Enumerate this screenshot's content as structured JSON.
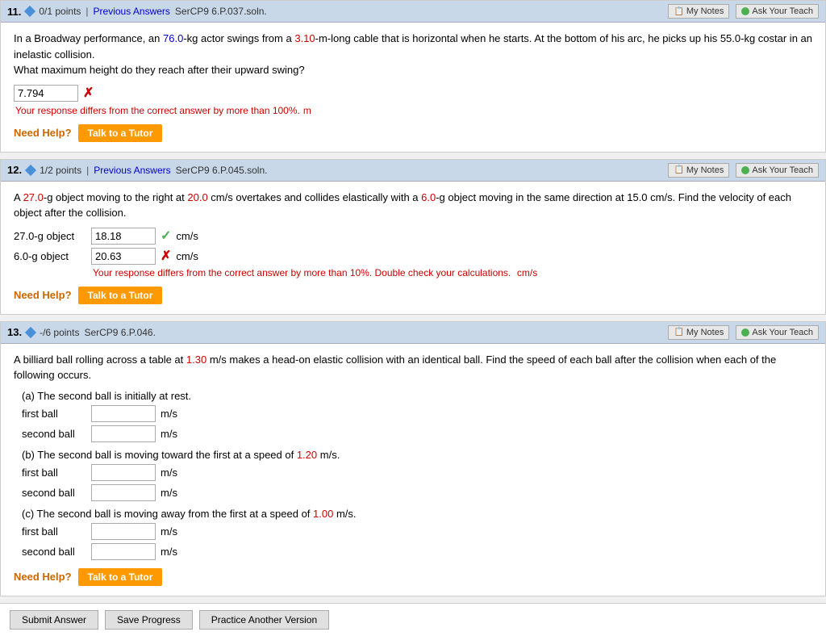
{
  "problems": [
    {
      "number": "11.",
      "points": "0/1 points",
      "prev_answers_label": "Previous Answers",
      "code": "SerCP9 6.P.037.soln.",
      "my_notes": "My Notes",
      "ask_teacher": "Ask Your Teach",
      "body": {
        "text_parts": [
          "In a Broadway performance, an ",
          "76.0",
          "-kg actor swings from a ",
          "3.10",
          "-m-long cable that is horizontal when he starts. At the bottom of his arc, he picks up his 55.0-kg costar in an inelastic collision.",
          " What maximum height do they reach after their upward swing?"
        ],
        "highlights": {
          "76.0": "blue",
          "3.10": "red"
        },
        "answer_value": "7.794",
        "answer_unit": "m",
        "answer_correct": false,
        "error_message": "Your response differs from the correct answer by more than 100%.",
        "error_unit": "m",
        "need_help": "Need Help?",
        "tutor_label": "Talk to a Tutor"
      }
    },
    {
      "number": "12.",
      "points": "1/2 points",
      "prev_answers_label": "Previous Answers",
      "code": "SerCP9 6.P.045.soln.",
      "my_notes": "My Notes",
      "ask_teacher": "Ask Your Teach",
      "body": {
        "text_parts": [
          "A ",
          "27.0",
          "-g object moving to the right at ",
          "20.0",
          " cm/s overtakes and collides elastically with a ",
          "6.0",
          "-g object moving in the same direction at 15.0 cm/s. Find the velocity of each object after the collision."
        ],
        "sub_answers": [
          {
            "label": "27.0-g object",
            "value": "18.18",
            "unit": "cm/s",
            "correct": true,
            "error_message": ""
          },
          {
            "label": "6.0-g object",
            "value": "20.63",
            "unit": "cm/s",
            "correct": false,
            "error_message": "Your response differs from the correct answer by more than 10%. Double check your calculations."
          }
        ],
        "need_help": "Need Help?",
        "tutor_label": "Talk to a Tutor"
      }
    },
    {
      "number": "13.",
      "points": "-/6 points",
      "prev_answers_label": "",
      "code": "SerCP9 6.P.046.",
      "my_notes": "My Notes",
      "ask_teacher": "Ask Your Teach",
      "body": {
        "intro": "A billiard ball rolling across a table at ",
        "speed": "1.30",
        "intro2": " m/s makes a head-on elastic collision with an identical ball. Find the speed of each ball after the collision when each of the following occurs.",
        "sub_questions": [
          {
            "label": "(a) The second ball is initially at rest.",
            "rows": [
              {
                "label": "first ball",
                "value": "",
                "unit": "m/s"
              },
              {
                "label": "second ball",
                "value": "",
                "unit": "m/s"
              }
            ]
          },
          {
            "label": "(b) The second ball is moving toward the first at a speed of ",
            "speed": "1.20",
            "label2": " m/s.",
            "rows": [
              {
                "label": "first ball",
                "value": "",
                "unit": "m/s"
              },
              {
                "label": "second ball",
                "value": "",
                "unit": "m/s"
              }
            ]
          },
          {
            "label": "(c) The second ball is moving away from the first at a speed of ",
            "speed": "1.00",
            "label2": " m/s.",
            "rows": [
              {
                "label": "first ball",
                "value": "",
                "unit": "m/s"
              },
              {
                "label": "second ball",
                "value": "",
                "unit": "m/s"
              }
            ]
          }
        ],
        "need_help": "Need Help?",
        "tutor_label": "Talk to a Tutor"
      }
    }
  ],
  "footer": {
    "submit": "Submit Answer",
    "save": "Save Progress",
    "practice": "Practice Another Version"
  }
}
